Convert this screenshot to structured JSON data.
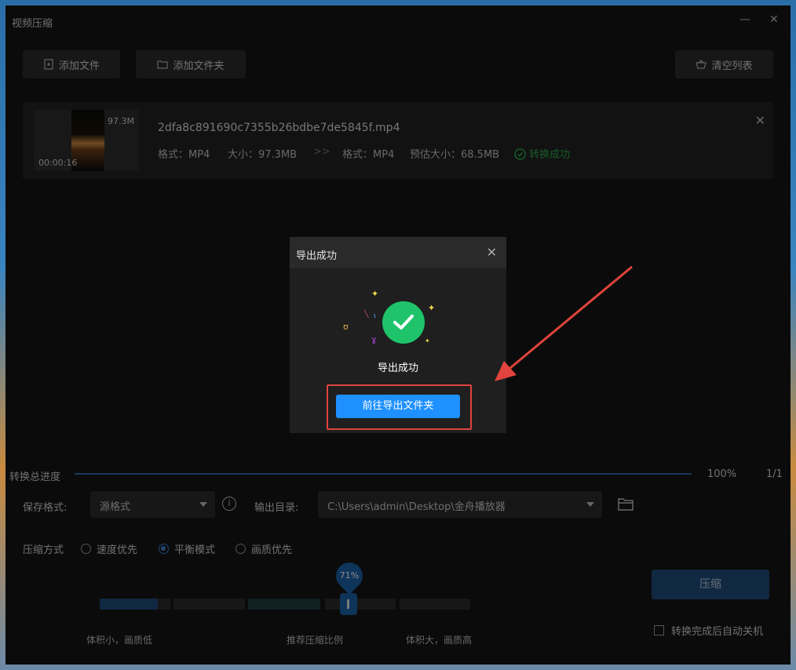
{
  "window": {
    "title": "视频压缩",
    "minimize": "—",
    "close": "✕"
  },
  "toolbar": {
    "add_file": "添加文件",
    "add_folder": "添加文件夹",
    "clear_list": "清空列表"
  },
  "file": {
    "thumb_size": "97.3M",
    "duration": "00:00:16",
    "name": "2dfa8c891690c7355b26bdbe7de5845f.mp4",
    "src_format": "格式：MP4",
    "src_size": "大小：97.3MB",
    "arrow": ">>",
    "dst_format": "格式：MP4",
    "est_size": "预估大小：68.5MB",
    "status": "转换成功"
  },
  "progress": {
    "label": "转换总进度",
    "percent": "100%",
    "count": "1/1"
  },
  "settings": {
    "save_format_label": "保存格式:",
    "save_format_value": "源格式",
    "output_dir_label": "输出目录:",
    "output_dir_value": "C:\\Users\\admin\\Desktop\\金舟播放器",
    "mode_label": "压缩方式",
    "modes": [
      "速度优先",
      "平衡模式",
      "画质优先"
    ],
    "selected_mode": "平衡模式"
  },
  "slider": {
    "value": "71%",
    "level": 0.71,
    "left_label": "体积小，画质低",
    "mid_label": "推荐压缩比例",
    "right_label": "体积大，画质高"
  },
  "actions": {
    "compress": "压缩",
    "auto_shutdown": "转换完成后自动关机"
  },
  "modal": {
    "title": "导出成功",
    "message": "导出成功",
    "button": "前往导出文件夹"
  },
  "colors": {
    "accent": "#1e90ff",
    "success": "#1fc46a",
    "highlight": "#e0443c"
  }
}
